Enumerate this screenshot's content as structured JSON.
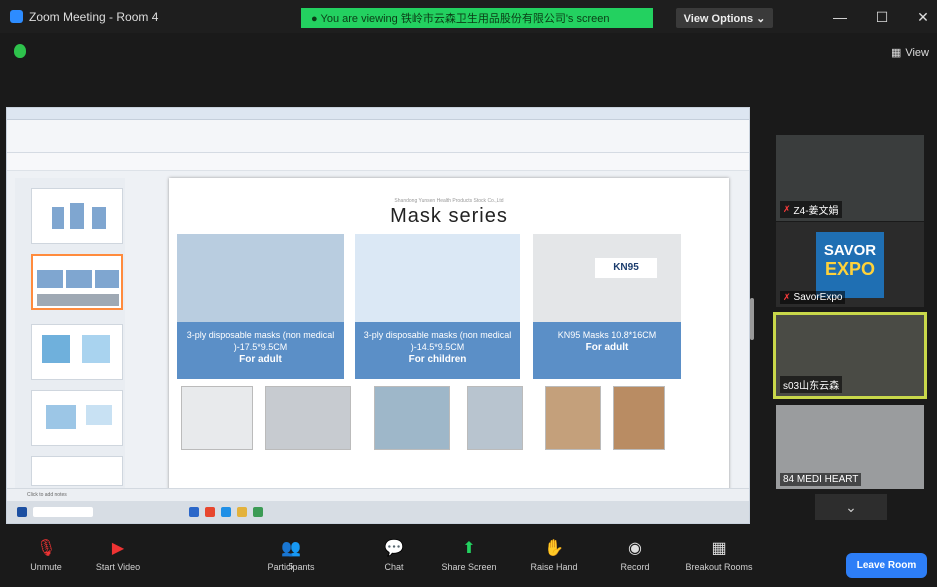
{
  "window": {
    "title": "Zoom Meeting - Room 4"
  },
  "banner": {
    "text": "● You are viewing 铁岭市云森卫生用品股份有限公司's screen"
  },
  "view_options": {
    "label": "View Options ⌄"
  },
  "view_button": {
    "label": "View"
  },
  "slide": {
    "subtitle": "Shandong Yunsen Health Products Stock Co.,Ltd",
    "title": "Mask series",
    "products": [
      {
        "caption": "3-ply disposable masks (non medical )-17.5*9.5CM",
        "for": "For adult"
      },
      {
        "caption": "3-ply disposable masks (non medical )-14.5*9.5CM",
        "for": "For children"
      },
      {
        "caption": "KN95 Masks 10.8*16CM",
        "for": "For adult"
      },
      {
        "caption": "KN95"
      }
    ]
  },
  "statusbar": {
    "text": "Click to add notes"
  },
  "participants": [
    {
      "name": "Z4-姜文娟",
      "muted": true
    },
    {
      "name": "SavorExpo",
      "muted": true,
      "logo_top": "SAVOR",
      "logo_bottom": "EXPO"
    },
    {
      "name": "s03山东云森",
      "muted": false
    },
    {
      "name": "84 MEDI HEART",
      "muted": false
    }
  ],
  "toolbar": {
    "unmute": "Unmute",
    "start_video": "Start Video",
    "participants": "Participants",
    "participants_count": "5",
    "chat": "Chat",
    "share_screen": "Share Screen",
    "raise_hand": "Raise Hand",
    "record": "Record",
    "breakout_rooms": "Breakout Rooms",
    "leave_room": "Leave Room"
  },
  "colors": {
    "accent": "#2d7ef7",
    "share_green": "#23d160",
    "active_speaker": "#c9d84a"
  }
}
